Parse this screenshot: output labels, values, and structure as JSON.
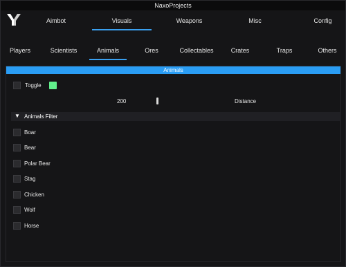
{
  "window": {
    "title": "NaxoProjects"
  },
  "main_tabs": [
    {
      "label": "Aimbot",
      "active": false
    },
    {
      "label": "Visuals",
      "active": true
    },
    {
      "label": "Weapons",
      "active": false
    },
    {
      "label": "Misc",
      "active": false
    },
    {
      "label": "Config",
      "active": false
    }
  ],
  "sub_tabs": [
    {
      "label": "Players",
      "active": false
    },
    {
      "label": "Scientists",
      "active": false
    },
    {
      "label": "Animals",
      "active": true
    },
    {
      "label": "Ores",
      "active": false
    },
    {
      "label": "Collectables",
      "active": false
    },
    {
      "label": "Crates",
      "active": false
    },
    {
      "label": "Traps",
      "active": false
    },
    {
      "label": "Others",
      "active": false
    }
  ],
  "section": {
    "title": "Animals",
    "toggle": {
      "label": "Toggle",
      "checked": false,
      "color": "#61f08c"
    },
    "distance": {
      "value": "200",
      "label": "Distance"
    },
    "filter": {
      "title": "Animals Filter",
      "items": [
        {
          "label": "Boar",
          "checked": false
        },
        {
          "label": "Bear",
          "checked": false
        },
        {
          "label": "Polar Bear",
          "checked": false
        },
        {
          "label": "Stag",
          "checked": false
        },
        {
          "label": "Chicken",
          "checked": false
        },
        {
          "label": "Wolf",
          "checked": false
        },
        {
          "label": "Horse",
          "checked": false
        }
      ]
    }
  },
  "colors": {
    "accent": "#2a9df4",
    "background": "#151517",
    "swatch": "#61f08c"
  }
}
